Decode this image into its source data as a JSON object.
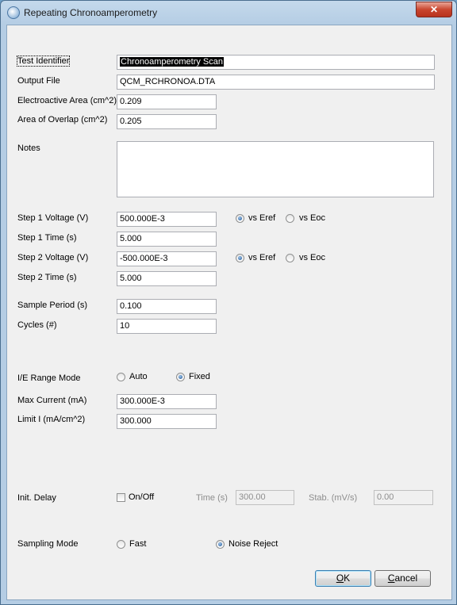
{
  "window": {
    "title": "Repeating Chronoamperometry",
    "close_glyph": "✕"
  },
  "fields": {
    "test_identifier": {
      "label": "Test Identifier",
      "value": "Chronoamperometry Scan"
    },
    "output_file": {
      "label": "Output File",
      "value": "QCM_RCHRONOA.DTA"
    },
    "electroactive_area": {
      "label": "Electroactive Area (cm^2)",
      "value": "0.209"
    },
    "area_of_overlap": {
      "label": "Area of Overlap (cm^2)",
      "value": "0.205"
    },
    "notes": {
      "label": "Notes",
      "value": ""
    },
    "step1_voltage": {
      "label": "Step 1 Voltage (V)",
      "value": "500.000E-3",
      "ref_options": [
        "vs Eref",
        "vs Eoc"
      ],
      "ref_selected": "vs Eref"
    },
    "step1_time": {
      "label": "Step 1 Time (s)",
      "value": "5.000"
    },
    "step2_voltage": {
      "label": "Step 2 Voltage (V)",
      "value": "-500.000E-3",
      "ref_options": [
        "vs Eref",
        "vs Eoc"
      ],
      "ref_selected": "vs Eref"
    },
    "step2_time": {
      "label": "Step 2 Time (s)",
      "value": "5.000"
    },
    "sample_period": {
      "label": "Sample Period (s)",
      "value": "0.100"
    },
    "cycles": {
      "label": "Cycles (#)",
      "value": "10"
    },
    "ie_range_mode": {
      "label": "I/E Range Mode",
      "options": [
        "Auto",
        "Fixed"
      ],
      "selected": "Fixed"
    },
    "max_current": {
      "label": "Max Current (mA)",
      "value": "300.000E-3"
    },
    "limit_i": {
      "label": "Limit I (mA/cm^2)",
      "value": "300.000"
    },
    "init_delay": {
      "label": "Init. Delay",
      "checkbox_label": "On/Off",
      "checked": false,
      "time_label": "Time (s)",
      "time_value": "300.00",
      "stab_label": "Stab. (mV/s)",
      "stab_value": "0.00"
    },
    "sampling_mode": {
      "label": "Sampling Mode",
      "options": [
        "Fast",
        "Noise Reject"
      ],
      "selected": "Noise Reject"
    }
  },
  "buttons": {
    "ok": {
      "mnemonic": "O",
      "rest": "K"
    },
    "cancel": {
      "mnemonic": "C",
      "rest": "ancel"
    }
  },
  "scroll_arrows": {
    "up": "▲",
    "down": "▼",
    "left": "◀",
    "right": "▶"
  }
}
